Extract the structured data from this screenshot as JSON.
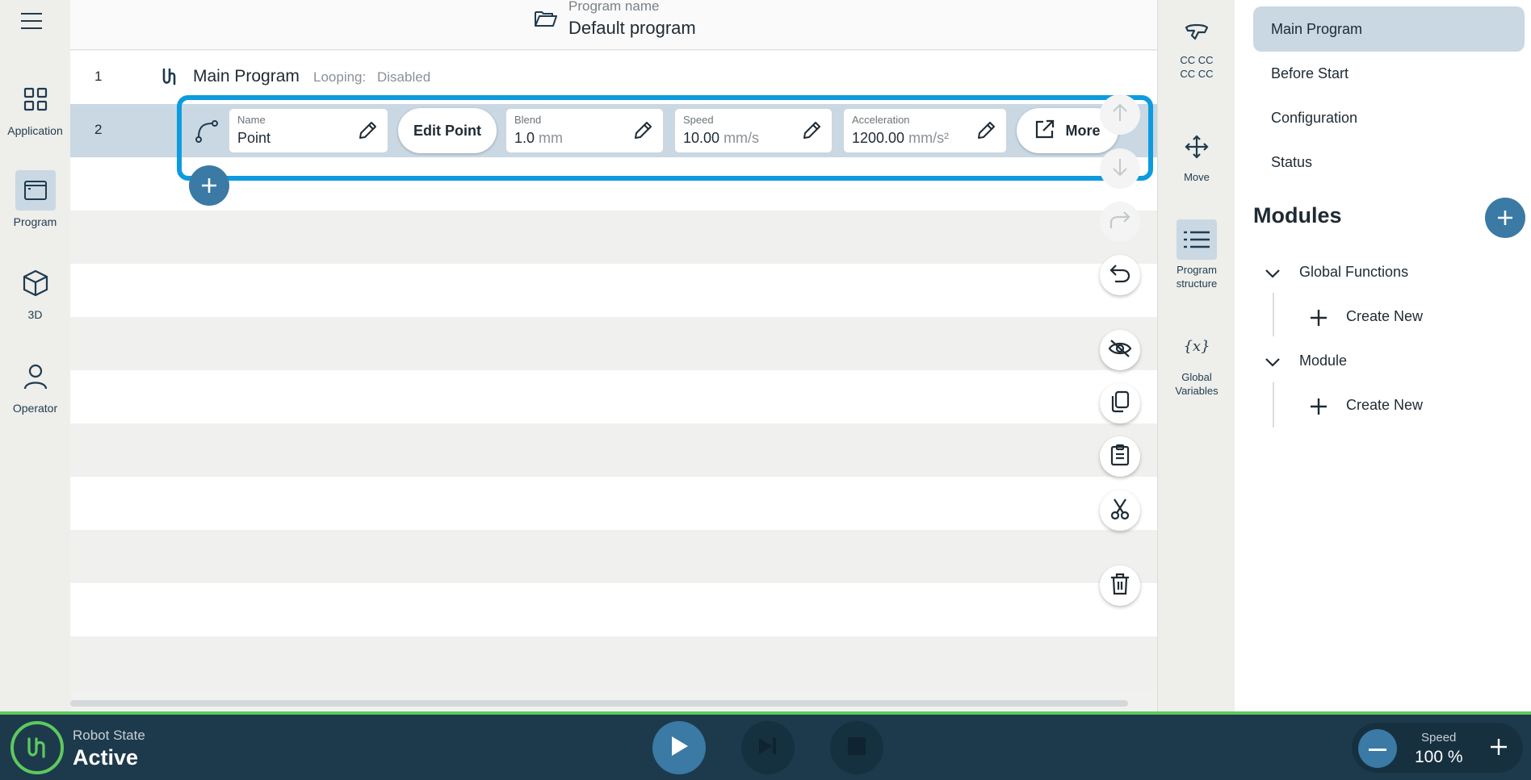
{
  "header": {
    "program_label": "Program name",
    "program_name": "Default program"
  },
  "nav": [
    {
      "label": "Application",
      "icon": "grid-icon"
    },
    {
      "label": "Program",
      "icon": "window-icon",
      "active": true
    },
    {
      "label": "3D",
      "icon": "cube-icon"
    },
    {
      "label": "Operator",
      "icon": "person-icon"
    }
  ],
  "program": {
    "row1": {
      "num": "1",
      "title": "Main Program",
      "loop_label": "Looping:",
      "loop_value": "Disabled"
    },
    "row2": {
      "num": "2"
    }
  },
  "toolbar": {
    "name_label": "Name",
    "name_value": "Point",
    "edit_point": "Edit Point",
    "blend_label": "Blend",
    "blend_value": "1.0",
    "blend_unit": "mm",
    "speed_label": "Speed",
    "speed_value": "10.00",
    "speed_unit": "mm/s",
    "accel_label": "Acceleration",
    "accel_value": "1200.00",
    "accel_unit": "mm/s²",
    "more": "More"
  },
  "tools": {
    "tcp_line1": "CC CC",
    "tcp_line2": "CC CC",
    "move": "Move",
    "structure_line1": "Program",
    "structure_line2": "structure",
    "vars_line1": "Global",
    "vars_line2": "Variables"
  },
  "right_panel": {
    "items": [
      "Main Program",
      "Before Start",
      "Configuration",
      "Status"
    ],
    "modules_title": "Modules",
    "tree": [
      {
        "label": "Global Functions",
        "child": "Create New"
      },
      {
        "label": "Module",
        "child": "Create New"
      }
    ]
  },
  "bottom": {
    "robot_state_label": "Robot State",
    "robot_state_value": "Active",
    "speed_label": "Speed",
    "speed_value": "100 %"
  },
  "colors": {
    "accent": "#3a7aa5",
    "highlight": "#0e9bde",
    "selected": "#c9d8e3",
    "status_green": "#5ec95e",
    "bottom_bar": "#1d3a4c"
  }
}
